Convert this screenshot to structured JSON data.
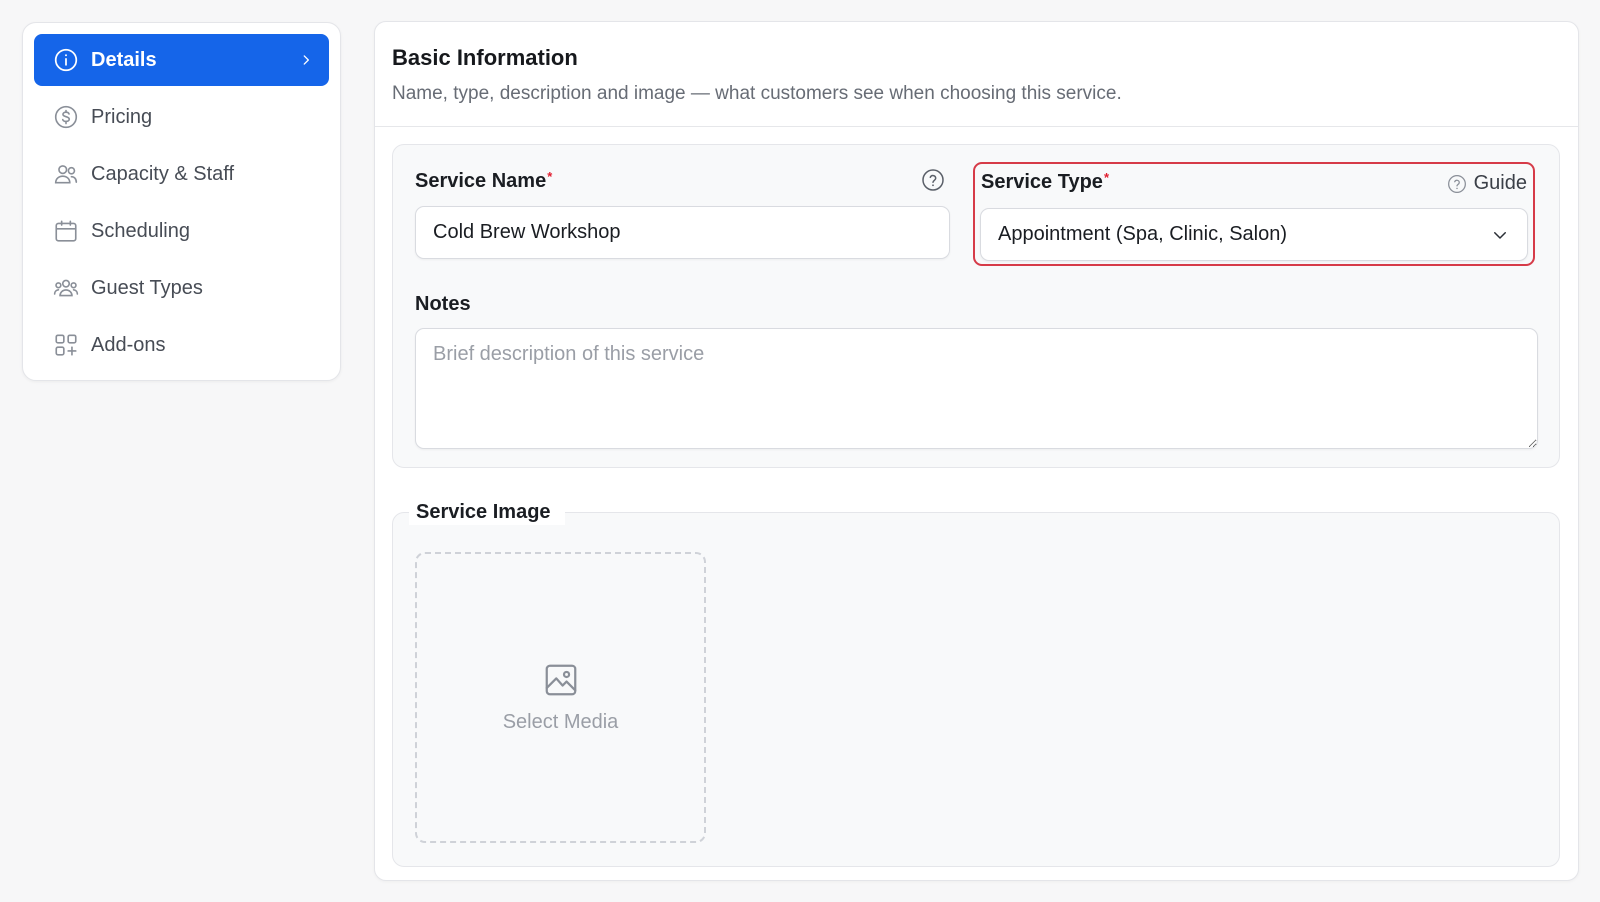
{
  "sidebar": {
    "items": [
      {
        "label": "Details",
        "icon": "info-circle-icon",
        "active": true
      },
      {
        "label": "Pricing",
        "icon": "dollar-circle-icon",
        "active": false
      },
      {
        "label": "Capacity & Staff",
        "icon": "users-icon",
        "active": false
      },
      {
        "label": "Scheduling",
        "icon": "calendar-icon",
        "active": false
      },
      {
        "label": "Guest Types",
        "icon": "user-group-icon",
        "active": false
      },
      {
        "label": "Add-ons",
        "icon": "grid-plus-icon",
        "active": false
      }
    ]
  },
  "main": {
    "title": "Basic Information",
    "subtitle": "Name, type, description and image — what customers see when choosing this service.",
    "service_name": {
      "label": "Service Name",
      "required_mark": "*",
      "value": "Cold Brew Workshop"
    },
    "service_type": {
      "label": "Service Type",
      "required_mark": "*",
      "guide_label": "Guide",
      "selected": "Appointment (Spa, Clinic, Salon)"
    },
    "notes": {
      "label": "Notes",
      "placeholder": "Brief description of this service"
    },
    "service_image": {
      "legend": "Service Image",
      "select_label": "Select Media"
    }
  },
  "colors": {
    "accent": "#1565e9",
    "highlight_border": "#d63b48",
    "required": "#e11d2e"
  }
}
